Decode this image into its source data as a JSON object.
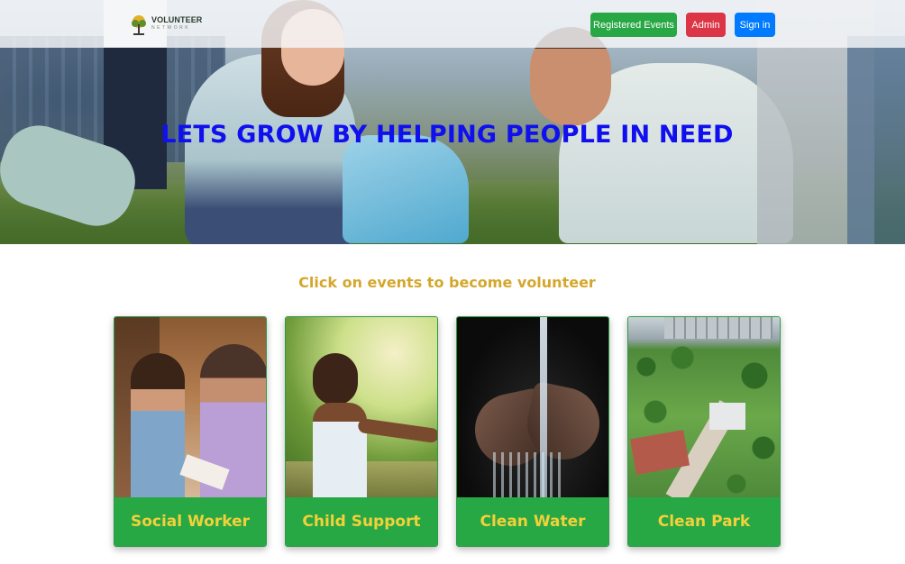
{
  "navbar": {
    "brand_name": "VOLUNTEER",
    "brand_subtitle": "NETWORK",
    "buttons": {
      "registered_events": "Registered Events",
      "admin": "Admin",
      "sign_in": "Sign in"
    }
  },
  "hero": {
    "title": "LETS GROW BY HELPING PEOPLE IN NEED"
  },
  "events_section": {
    "heading": "Click on events to become volunteer",
    "events": [
      {
        "label": "Social Worker"
      },
      {
        "label": "Child Support"
      },
      {
        "label": "Clean Water"
      },
      {
        "label": "Clean Park"
      }
    ]
  },
  "colors": {
    "brand_green": "#28a745",
    "danger_red": "#dc3545",
    "primary_blue": "#007bff",
    "hero_title_blue": "#1010ee",
    "heading_gold": "#d4a72c",
    "card_label_yellow": "#f2d13a"
  }
}
